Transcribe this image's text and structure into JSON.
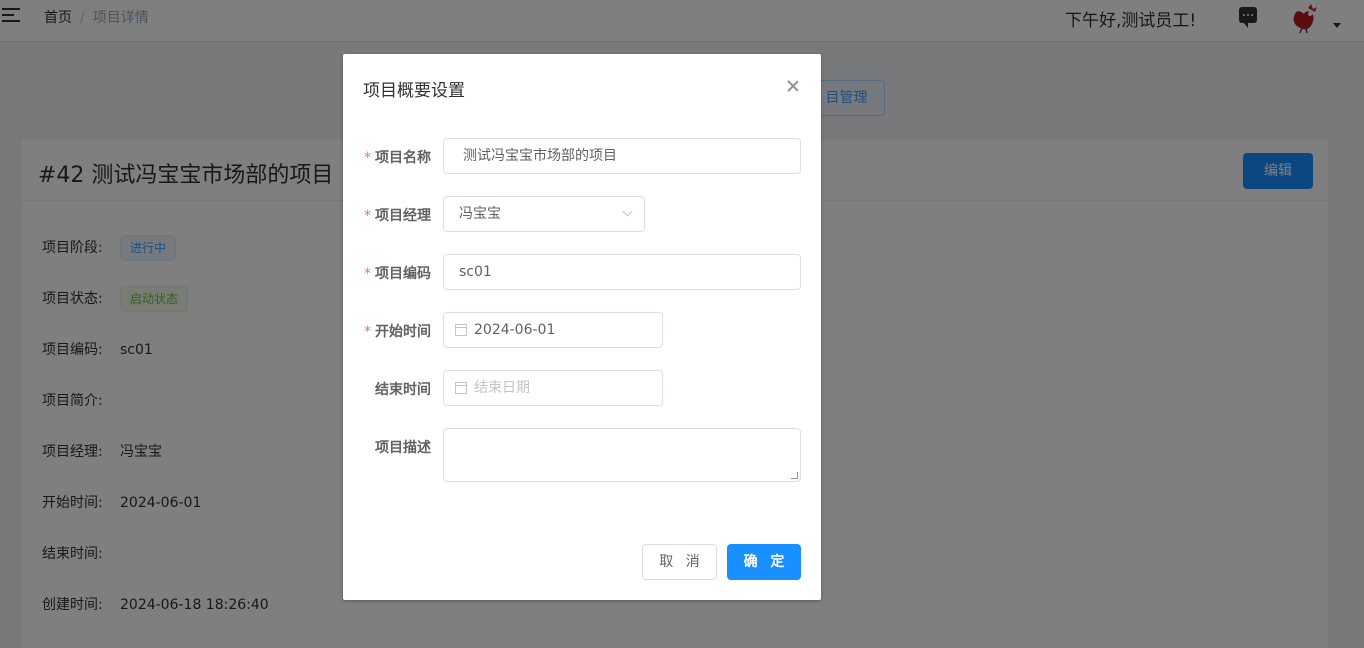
{
  "topbar": {
    "breadcrumb": {
      "home": "首页",
      "separator": "/",
      "current": "项目详情"
    },
    "greeting": "下午好,测试员工!",
    "icons": [
      "menu-fold-icon",
      "chat-icon",
      "avatar",
      "caret-down-icon"
    ]
  },
  "toolbar": {
    "project_management_label": "目管理"
  },
  "project_card": {
    "title": "#42 测试冯宝宝市场部的项目",
    "edit_label": "编辑",
    "fields": {
      "stage": {
        "label": "项目阶段:",
        "value": "进行中"
      },
      "status": {
        "label": "项目状态:",
        "value": "启动状态"
      },
      "code": {
        "label": "项目编码:",
        "value": "sc01"
      },
      "intro": {
        "label": "项目简介:",
        "value": ""
      },
      "manager": {
        "label": "项目经理:",
        "value": "冯宝宝"
      },
      "start": {
        "label": "开始时间:",
        "value": "2024-06-01"
      },
      "end": {
        "label": "结束时间:",
        "value": ""
      },
      "created": {
        "label": "创建时间:",
        "value": "2024-06-18 18:26:40"
      }
    }
  },
  "dialog": {
    "title": "项目概要设置",
    "required_mark": "*",
    "form": {
      "name": {
        "label": "项目名称",
        "value": "测试冯宝宝市场部的项目"
      },
      "manager": {
        "label": "项目经理",
        "value": "冯宝宝"
      },
      "code": {
        "label": "项目编码",
        "value": "sc01"
      },
      "start": {
        "label": "开始时间",
        "value": "2024-06-01"
      },
      "end": {
        "label": "结束时间",
        "placeholder": "结束日期"
      },
      "description": {
        "label": "项目描述",
        "value": ""
      }
    },
    "cancel_label": "取 消",
    "confirm_label": "确 定"
  },
  "colors": {
    "primary": "#1890ff",
    "danger": "#f56c6c",
    "overlay": "rgba(0,0,0,0.5)"
  }
}
